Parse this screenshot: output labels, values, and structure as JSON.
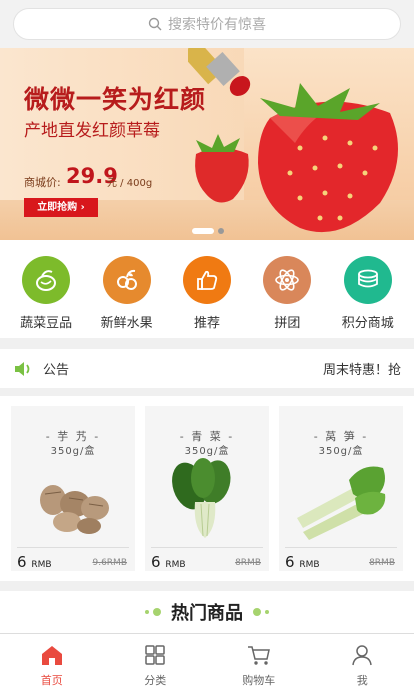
{
  "search": {
    "placeholder": "搜索特价有惊喜"
  },
  "banner": {
    "title": "微微一笑为红颜",
    "subtitle": "产地直发红颜草莓",
    "price_label": "商城价:",
    "price": "29.9",
    "unit": "元 / 400g",
    "cta": "立即抢购 ›",
    "active_slide": 1,
    "slide_count": 2
  },
  "categories": [
    {
      "label": "蔬菜豆品",
      "icon": "vegetable-icon",
      "color": "#7dbb2b"
    },
    {
      "label": "新鲜水果",
      "icon": "fruit-icon",
      "color": "#e68a2e"
    },
    {
      "label": "推荐",
      "icon": "thumbs-up-icon",
      "color": "#f07a12"
    },
    {
      "label": "拼团",
      "icon": "atom-icon",
      "color": "#d9875a"
    },
    {
      "label": "积分商城",
      "icon": "coins-icon",
      "color": "#20b98f"
    }
  ],
  "notice": {
    "title": "公告",
    "text": "周末特惠！抢"
  },
  "products": [
    {
      "name": "- 芋 艿 -",
      "spec": "350g/盒",
      "price": "6",
      "currency": "RMB",
      "old_price": "9.6RMB"
    },
    {
      "name": "- 青 菜 -",
      "spec": "350g/盒",
      "price": "6",
      "currency": "RMB",
      "old_price": "8RMB"
    },
    {
      "name": "- 莴 笋 -",
      "spec": "350g/盒",
      "price": "6",
      "currency": "RMB",
      "old_price": "8RMB"
    }
  ],
  "hot": {
    "title": "热门商品"
  },
  "tabbar": [
    {
      "label": "首页",
      "icon": "home-icon",
      "active": true
    },
    {
      "label": "分类",
      "icon": "grid-icon",
      "active": false
    },
    {
      "label": "购物车",
      "icon": "cart-icon",
      "active": false
    },
    {
      "label": "我",
      "icon": "user-icon",
      "active": false
    }
  ],
  "colors": {
    "accent": "#e94a3f",
    "banner_red": "#c0161c"
  }
}
